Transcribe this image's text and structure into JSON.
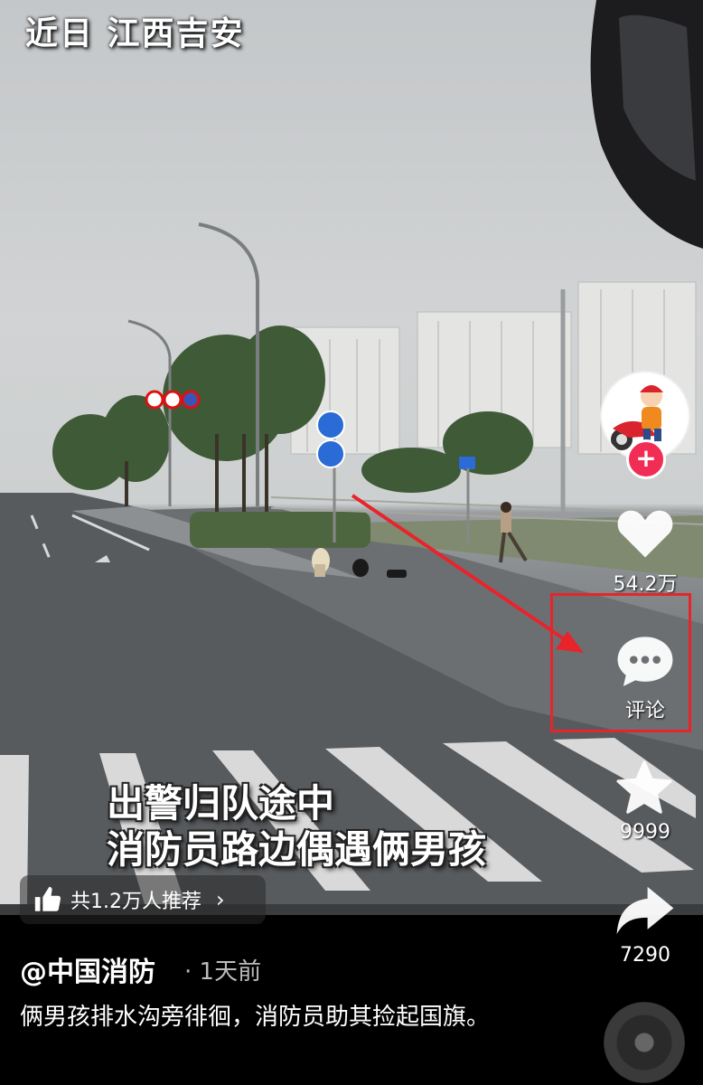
{
  "video": {
    "location_caption": "近日 江西吉安",
    "subtitle_line1": "出警归队途中",
    "subtitle_line2": "消防员路边偶遇俩男孩"
  },
  "recommend": {
    "label": "共1.2万人推荐",
    "chevron": "›",
    "icon": "thumbs-up-icon"
  },
  "actions": {
    "follow_symbol": "+",
    "like_count": "54.2万",
    "comment_label": "评论",
    "favorite_count": "9999",
    "share_count": "7290"
  },
  "post": {
    "author": "@中国消防",
    "time": "· 1天前",
    "description": "俩男孩排水沟旁徘徊，消防员助其捡起国旗。"
  },
  "colors": {
    "highlight": "#e8242b",
    "follow_button": "#f12c55"
  }
}
